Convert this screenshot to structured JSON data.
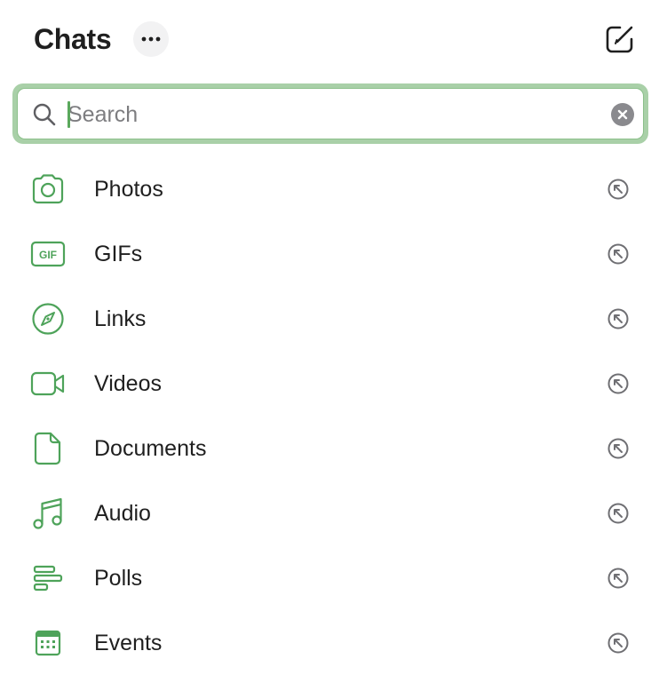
{
  "header": {
    "title": "Chats",
    "more_icon": "ellipsis-icon",
    "compose_icon": "compose-icon"
  },
  "search": {
    "placeholder": "Search",
    "value": "",
    "icon": "search-icon",
    "clear_icon": "clear-icon"
  },
  "colors": {
    "accent": "#4ea35a",
    "focus_ring": "#a9d0a8",
    "muted_icon": "#8a8a8e"
  },
  "filters": [
    {
      "label": "Photos",
      "icon": "camera-icon"
    },
    {
      "label": "GIFs",
      "icon": "gif-icon",
      "icon_text": "GIF"
    },
    {
      "label": "Links",
      "icon": "compass-icon"
    },
    {
      "label": "Videos",
      "icon": "video-camera-icon"
    },
    {
      "label": "Documents",
      "icon": "document-icon"
    },
    {
      "label": "Audio",
      "icon": "music-note-icon"
    },
    {
      "label": "Polls",
      "icon": "poll-icon"
    },
    {
      "label": "Events",
      "icon": "calendar-icon"
    }
  ]
}
